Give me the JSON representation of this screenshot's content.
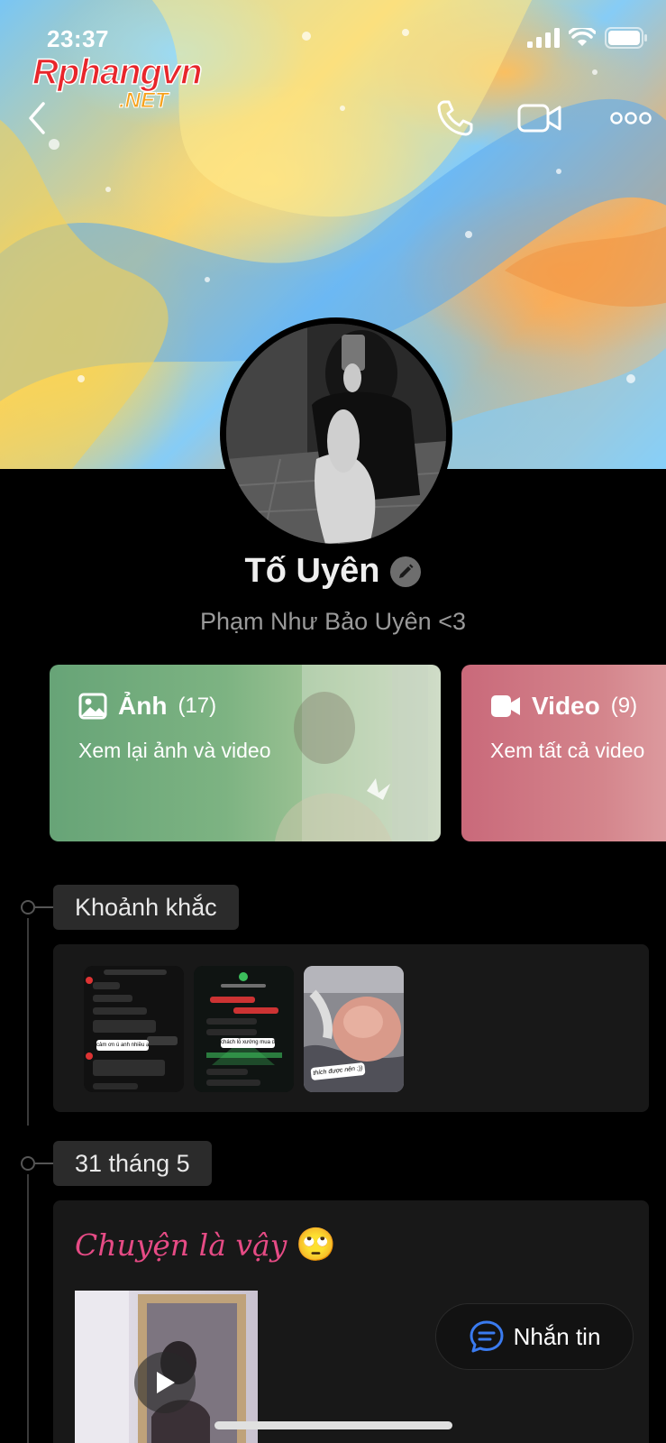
{
  "status_bar": {
    "time": "23:37"
  },
  "watermark": {
    "main": "Rphangvn",
    "sub": ".NET"
  },
  "header": {
    "back_icon": "chevron-left-icon",
    "call_icon": "phone-icon",
    "video_call_icon": "video-camera-icon",
    "more_icon": "ellipsis-icon"
  },
  "profile": {
    "name": "Tố Uyên",
    "nickname": "Phạm Như Bảo Uyên <3"
  },
  "media_cards": {
    "photos": {
      "title": "Ảnh",
      "count": "(17)",
      "subtitle": "Xem lại ảnh và video",
      "color": "#67a477"
    },
    "videos": {
      "title": "Video",
      "count": "(9)",
      "subtitle": "Xem tất cả video",
      "color": "#c9697a"
    }
  },
  "timeline": {
    "moments_label": "Khoảnh khắc",
    "moment_thumbs": [
      {
        "caption": "cảm ơn ú anh nhiều ạ"
      },
      {
        "caption": "chách lỗ xướng mua dịch ạ"
      },
      {
        "caption": "thích được nên :))"
      }
    ],
    "date_label": "31 tháng 5",
    "post": {
      "title": "Chuyện là vậy",
      "emoji": "🙄"
    }
  },
  "message_button": {
    "label": "Nhắn tin"
  },
  "colors": {
    "accent_pink": "#e64b85",
    "accent_blue": "#3a7bf0"
  }
}
